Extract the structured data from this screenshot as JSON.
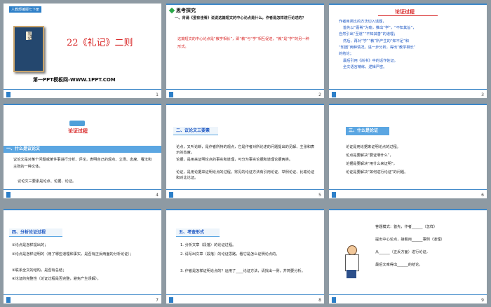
{
  "slides": [
    {
      "badge": "人教部编版七下册",
      "book_text": "礼记",
      "title": "22《礼记》二则",
      "subtitle": "第一PPT模板网-WWW.1PPT.COM",
      "page": "1"
    },
    {
      "header": "思考探究",
      "q": "一、背诵《虽有佳肴》说说这篇短文的中心论点是什么。作者是怎样进行论述的？",
      "answer": "这篇短文的中心论点是“教学相长”，即“教”与“学”相互促进，“教”是“学”的另一种形式。",
      "page": "2"
    },
    {
      "title": "论证过程",
      "lines": [
        "作者用类比的方法切入话题，",
        "首先以“嘉肴”为喻，推出“学”，“不知其旨”，",
        "自然引出“至道”“不知其善”的道理；",
        "然后，再对“学”“教”所产生的“知不足”和",
        "“知困”两种情况，进一步分析，得出“教学相长”",
        "的结论；",
        "最后引用《尚书》中的话作佐证。",
        "全文语言精练，逻辑严密。"
      ],
      "page": "3"
    },
    {
      "header": "论证过程",
      "sec": "一、什么是议论文",
      "lines": [
        "议论文是对某个问题或某件事进行分析、评论，表明自己的观点、立场、态度、看法和主张的一种文体。",
        "议论文三要素是论点、论据、论证。"
      ],
      "page": "4"
    },
    {
      "sec": "二、议论文三要素",
      "lines": [
        "论点，又叫论断，是作者所持的观点，它是作者对所论述的问题提出的见解、主张和表示的态度。",
        "论据，是用来证明论点的事实和道理，可分为事实论据和道理论据两类。",
        "论证，是用论据来证明论点的过程。常见的论证方法有引用论证、举例论证、比喻论证和对比论证。"
      ],
      "page": "5"
    },
    {
      "sec": "三、什么是论证",
      "lines": [
        "论证是用论据来证明论点的过程。",
        "论点是要解决“要证明什么”，",
        "论据是要解决“用什么来证明”，",
        "论证是要解决“如何进行论证”的问题。"
      ],
      "page": "6"
    },
    {
      "sec": "四、分析论证过程",
      "lines": [
        "①论点是怎样提出的；",
        "②论点是怎样证明的（用了哪些道理和事实，是否有正反两面的分析论证）；",
        "③联系全文的结构，是否有总结；",
        "④论证的完整性（论证过程是否完整，避免产生误解）。"
      ],
      "page": "7"
    },
    {
      "sec": "五、考查形式",
      "lines": [
        "1. 分析文章（段落）的论证过程。",
        "2. 请写出文章（段落）的论证思路，看它是怎么证明论点的。",
        "3. 作者是怎样证明论点的？运用了____论证方法，请找出一例，并简要分析。"
      ],
      "page": "8"
    },
    {
      "sec": "答题模式",
      "lines": [
        "答题模式：首先，作者______（怎样）",
        "提出中心论点，接着用______事例（道理）",
        "从______（正反方面）进行论证，",
        "最后文章得出______的结论。"
      ],
      "page": "9"
    }
  ],
  "colors": {
    "accent_red": "#d72222",
    "accent_blue": "#1a55c2",
    "bar": "#5ba6e2"
  }
}
